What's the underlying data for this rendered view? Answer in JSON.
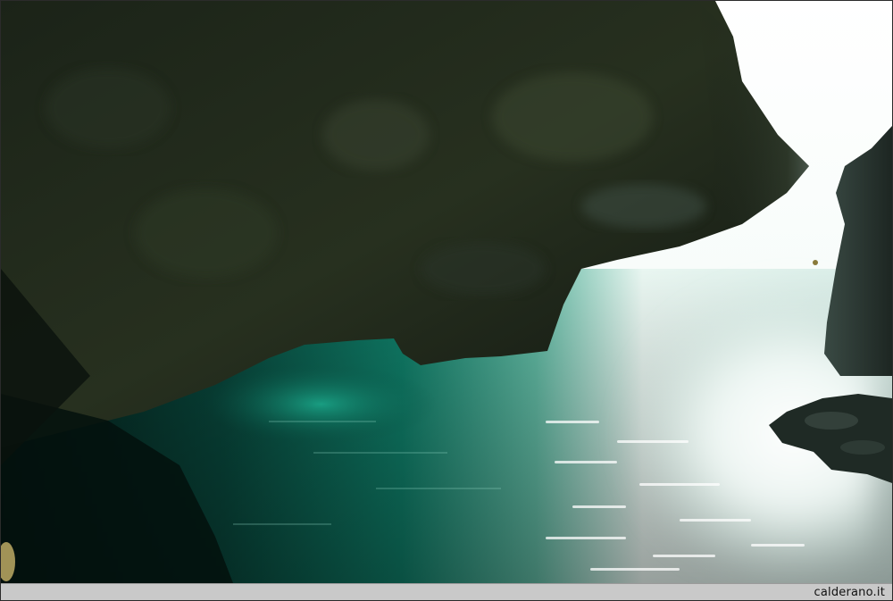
{
  "photo": {
    "subject": "sea-cave-arch",
    "colors": {
      "rock_dark": "#141a13",
      "rock_mid": "#2a3324",
      "water_teal": "#0f8a72",
      "water_deep": "#06231f",
      "light": "#ffffff"
    }
  },
  "footer": {
    "watermark": "calderano.it"
  }
}
